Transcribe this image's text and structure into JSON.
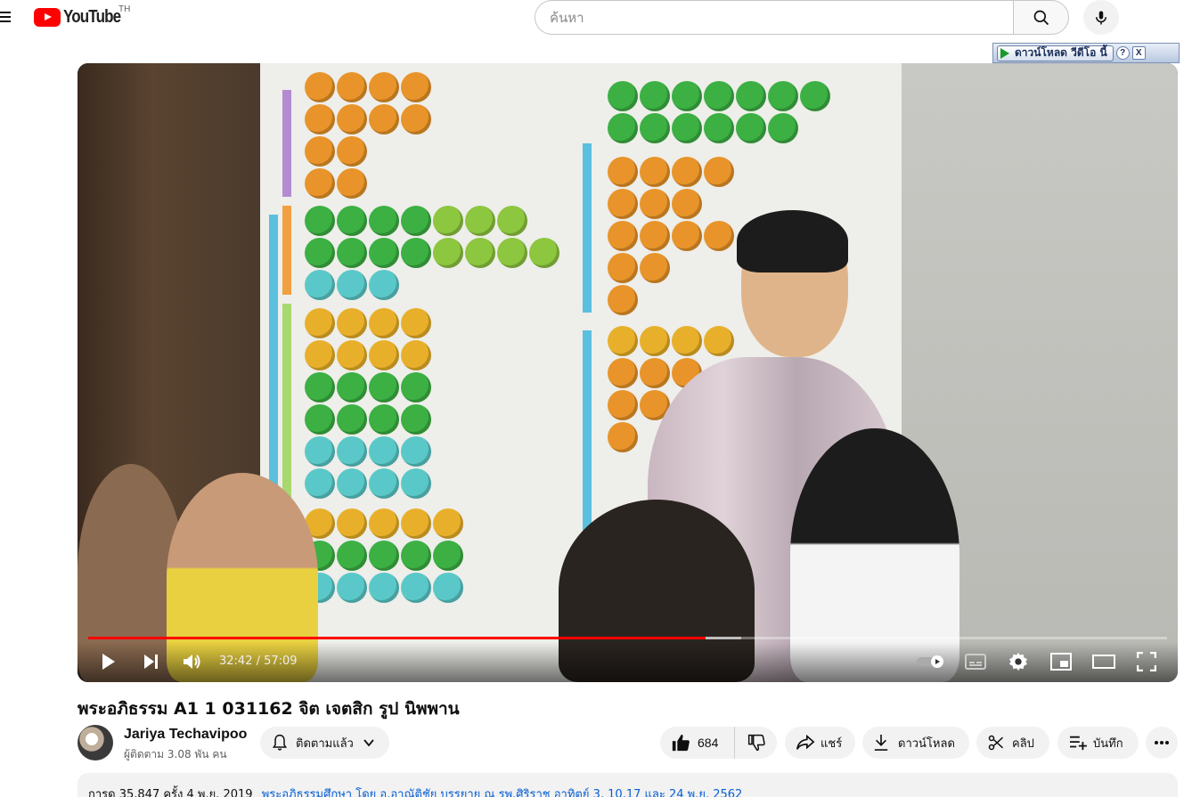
{
  "masthead": {
    "logo_text": "YouTube",
    "country_code": "TH",
    "search_placeholder": "ค้นหา",
    "icons": {
      "menu": "hamburger-icon",
      "search": "search-icon",
      "mic": "mic-icon"
    }
  },
  "plugin": {
    "download_label": "ดาวน์โหลด วีดีโอ นี้",
    "help_label": "?",
    "close_label": "X"
  },
  "player": {
    "current_time": "32:42",
    "duration": "57:09",
    "time_display": "32:42 / 57:09",
    "progress_played_fraction": 0.572,
    "progress_buffered_fraction": 0.605,
    "progress_color": "#ff0000",
    "icons": [
      "play-icon",
      "next-icon",
      "volume-icon",
      "autoplay-toggle-icon",
      "captions-icon",
      "settings-icon",
      "miniplayer-icon",
      "theater-icon",
      "fullscreen-icon"
    ]
  },
  "video": {
    "title": "พระอภิธรรม A1 1 031162 จิต เจตสิก รูป นิพพาน"
  },
  "channel": {
    "name": "Jariya Techavipoo",
    "subscribers": "ผู้ติดตาม 3.08 พัน คน",
    "subscribed_label": "ติดตามแล้ว"
  },
  "actions": {
    "like_count": "684",
    "share_label": "แชร์",
    "download_label": "ดาวน์โหลด",
    "clip_label": "คลิป",
    "save_label": "บันทึก"
  },
  "description": {
    "stats": "การดู 35,847 ครั้ง  4 พ.ย. 2019",
    "link_text": "พระอภิธรรมศึกษา โดย อ.อาณัติชัย บรรยาย ณ รพ.ศิริราช อาทิตย์ 3, 10,17 และ 24 พ.ย. 2562"
  }
}
